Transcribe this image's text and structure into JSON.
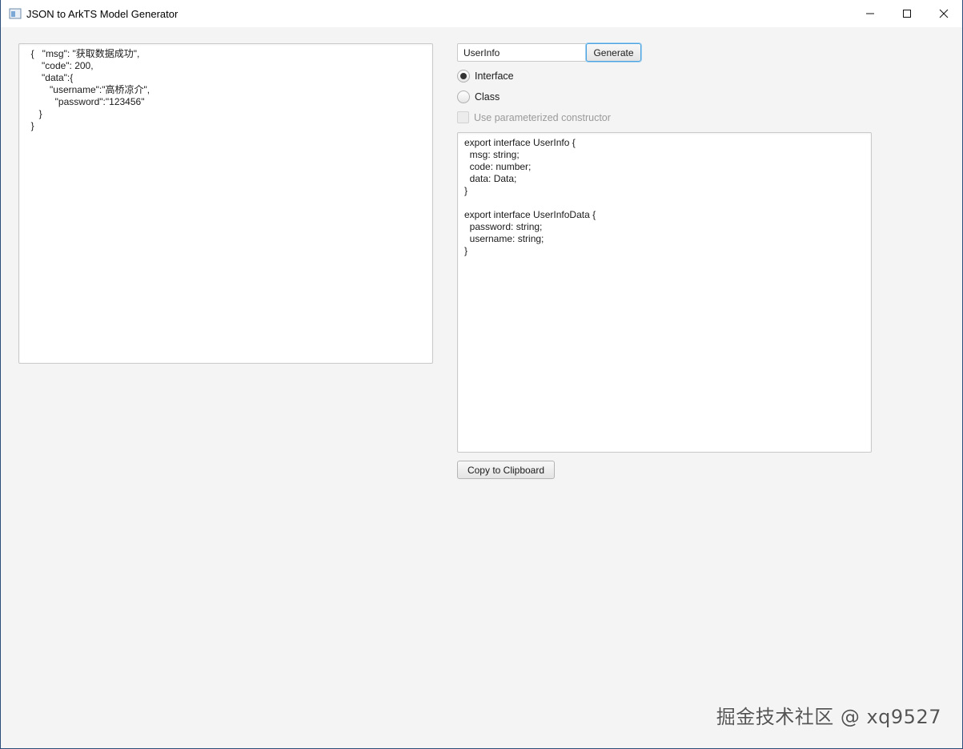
{
  "window": {
    "title": "JSON to ArkTS Model Generator"
  },
  "input_json": {
    "text": "  {   \"msg\": \"获取数据成功\",\n      \"code\": 200,\n      \"data\":{\n         \"username\":\"高桥凉介\",\n           \"password\":\"123456\"\n     }\n  }"
  },
  "controls": {
    "class_name_value": "UserInfo",
    "generate_label": "Generate",
    "radio_interface_label": "Interface",
    "radio_class_label": "Class",
    "radio_selected": "Interface",
    "checkbox_label": "Use parameterized constructor",
    "checkbox_enabled": false,
    "checkbox_checked": false
  },
  "output": {
    "text": "export interface UserInfo {\n  msg: string;\n  code: number;\n  data: Data;\n}\n\nexport interface UserInfoData {\n  password: string;\n  username: string;\n}"
  },
  "copy_button_label": "Copy to Clipboard",
  "watermark": "掘金技术社区 @ xq9527",
  "colors": {
    "window_bg": "#f4f4f4",
    "focus_accent": "#4aa3df"
  }
}
